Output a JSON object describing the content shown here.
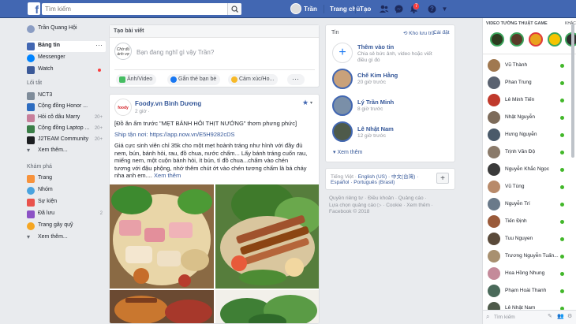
{
  "topbar": {
    "search_placeholder": "Tìm kiếm",
    "user": "Trần",
    "home": "Trang chủ",
    "create": "Tạo",
    "notif_count": "7"
  },
  "left": {
    "profile": "Trần Quang Hội",
    "newsfeed": "Bảng tin",
    "messenger": "Messenger",
    "watch": "Watch",
    "shortcuts_header": "Lối tắt",
    "shortcuts": [
      {
        "label": "NCT3",
        "count": ""
      },
      {
        "label": "Cộng đồng Honor ...",
        "count": ""
      },
      {
        "label": "Hỏi cô dâu Marry",
        "count": "20+"
      },
      {
        "label": "Cộng đồng Laptop ...",
        "count": "20+"
      },
      {
        "label": "J2TEAM Community",
        "count": "20+"
      }
    ],
    "see_more1": "Xem thêm...",
    "explore_header": "Khám phá",
    "explore": [
      "Trang",
      "Nhóm",
      "Sự kiện",
      "Đã lưu",
      "Trang gây quỹ"
    ],
    "explore_count": "2",
    "see_more2": "Xem thêm..."
  },
  "composer": {
    "title": "Tạo bài viết",
    "placeholder": "Bạn đang nghĩ gì vậy Trần?",
    "photo": "Ảnh/Video",
    "tag": "Gắn thẻ bạn bè",
    "feeling": "Cảm xúc/Ho..."
  },
  "post": {
    "page": "Foody.vn Bình Dương",
    "time": "2 giờ ·",
    "line1": "[Đồ ăn ấm trước \"MẸT BÁNH HỎI THỊT NƯỚNG\" thơm phưng phức]",
    "ship": "Ship tận nơi: https://app.now.vn/E5H9282cDS",
    "body1": "Giá cực sinh viên chỉ 35k cho một mẹt hoành tráng như hình với đầy đủ",
    "body2": "nem, bún, bánh hỏi, rau, đồ chua, nước chấm... Lấy bánh tráng cuốn rau,",
    "body3": "miếng nem, một cuộn bánh hỏi, ít bún, tí đồ chua...chấm vào chén",
    "body4": "tương với đậu phộng, nhớ thêm chút ớt vào chén tương chấm là bá cháy",
    "body5": "nha anh em.... ",
    "see_more": "Xem thêm"
  },
  "stories": {
    "title": "Tin",
    "archive": "Kho lưu trữ",
    "settings": "Cài đặt",
    "add": "Thêm vào tin",
    "add_desc1": "Chia sẻ bức ảnh, video hoặc viết",
    "add_desc2": "điều gì đó",
    "items": [
      {
        "name": "Chế Kim Hằng",
        "time": "20 giờ trước"
      },
      {
        "name": "Lý Trần Minh",
        "time": "8 giờ trước"
      },
      {
        "name": "Lê Nhật Nam",
        "time": "12 giờ trước"
      }
    ],
    "see_more": "Xem thêm"
  },
  "lang": {
    "line1a": "Tiếng Việt · ",
    "line1b": "English (US) · 中文(台灣) ·",
    "line2": "Español · Português (Brasil)"
  },
  "footer": {
    "line1": "Quyền riêng tư · Điều khoản · Quảng cáo ·",
    "line2": "Lựa chọn quảng cáo ▷ · Cookie · Xem thêm ·",
    "line3": "Facebook © 2018"
  },
  "right": {
    "game_header": "VIDEO TƯỜNG THUẬT GAME",
    "game_more": "KHÁC",
    "contacts": [
      "Vũ Thành",
      "Phan Trung",
      "Lê Minh Tiến",
      "Nhật Nguyễn",
      "Hưng Nguyễn",
      "Trịnh Văn Độ",
      "Nguyễn Khắc Ngọc",
      "Vũ Tùng",
      "Nguyễn Trí",
      "Tiến Định",
      "Tuu Nguyen",
      "Trương Nguyễn Tuấn...",
      "Hoa Hồng Nhung",
      "Phạm Hoài Thanh",
      "Lê Nhật Nam"
    ],
    "search_placeholder": "Tìm kiếm"
  },
  "colors": {
    "brand": "#4267b2",
    "online": "#42b72a"
  }
}
